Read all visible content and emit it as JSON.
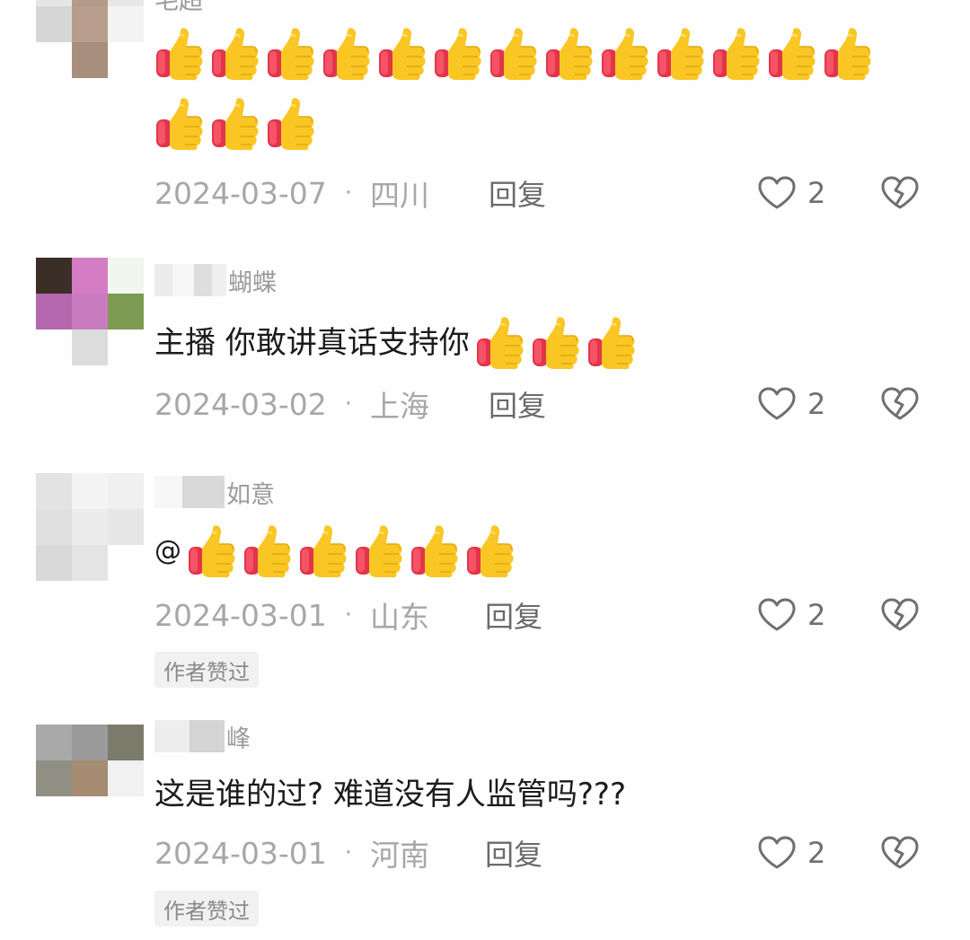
{
  "comments": [
    {
      "username_visible": "毛超",
      "text": "",
      "emoji_count": 16,
      "emoji": "thumbs-up-icon",
      "date": "2024-03-07",
      "location": "四川",
      "reply_label": "回复",
      "likes": "2",
      "author_liked": false
    },
    {
      "username_visible": "蝴蝶",
      "text": "主播 你敢讲真话支持你",
      "emoji_count": 3,
      "emoji": "thumbs-up-icon",
      "date": "2024-03-02",
      "location": "上海",
      "reply_label": "回复",
      "likes": "2",
      "author_liked": false
    },
    {
      "username_visible": "如意",
      "text": "@",
      "emoji_count": 6,
      "emoji": "thumbs-up-icon",
      "date": "2024-03-01",
      "location": "山东",
      "reply_label": "回复",
      "likes": "2",
      "author_liked": true,
      "author_liked_label": "作者赞过"
    },
    {
      "username_visible": "峰",
      "text": "这是谁的过? 难道没有人监管吗???",
      "emoji_count": 0,
      "date": "2024-03-01",
      "location": "河南",
      "reply_label": "回复",
      "likes": "2",
      "author_liked": true,
      "author_liked_label": "作者赞过"
    }
  ],
  "colors": {
    "background": "#fefefe",
    "text": "#1b1b1b",
    "meta": "#a7a7a7",
    "thumb_yellow": "#f9c623",
    "thumb_red": "#e4344a"
  }
}
